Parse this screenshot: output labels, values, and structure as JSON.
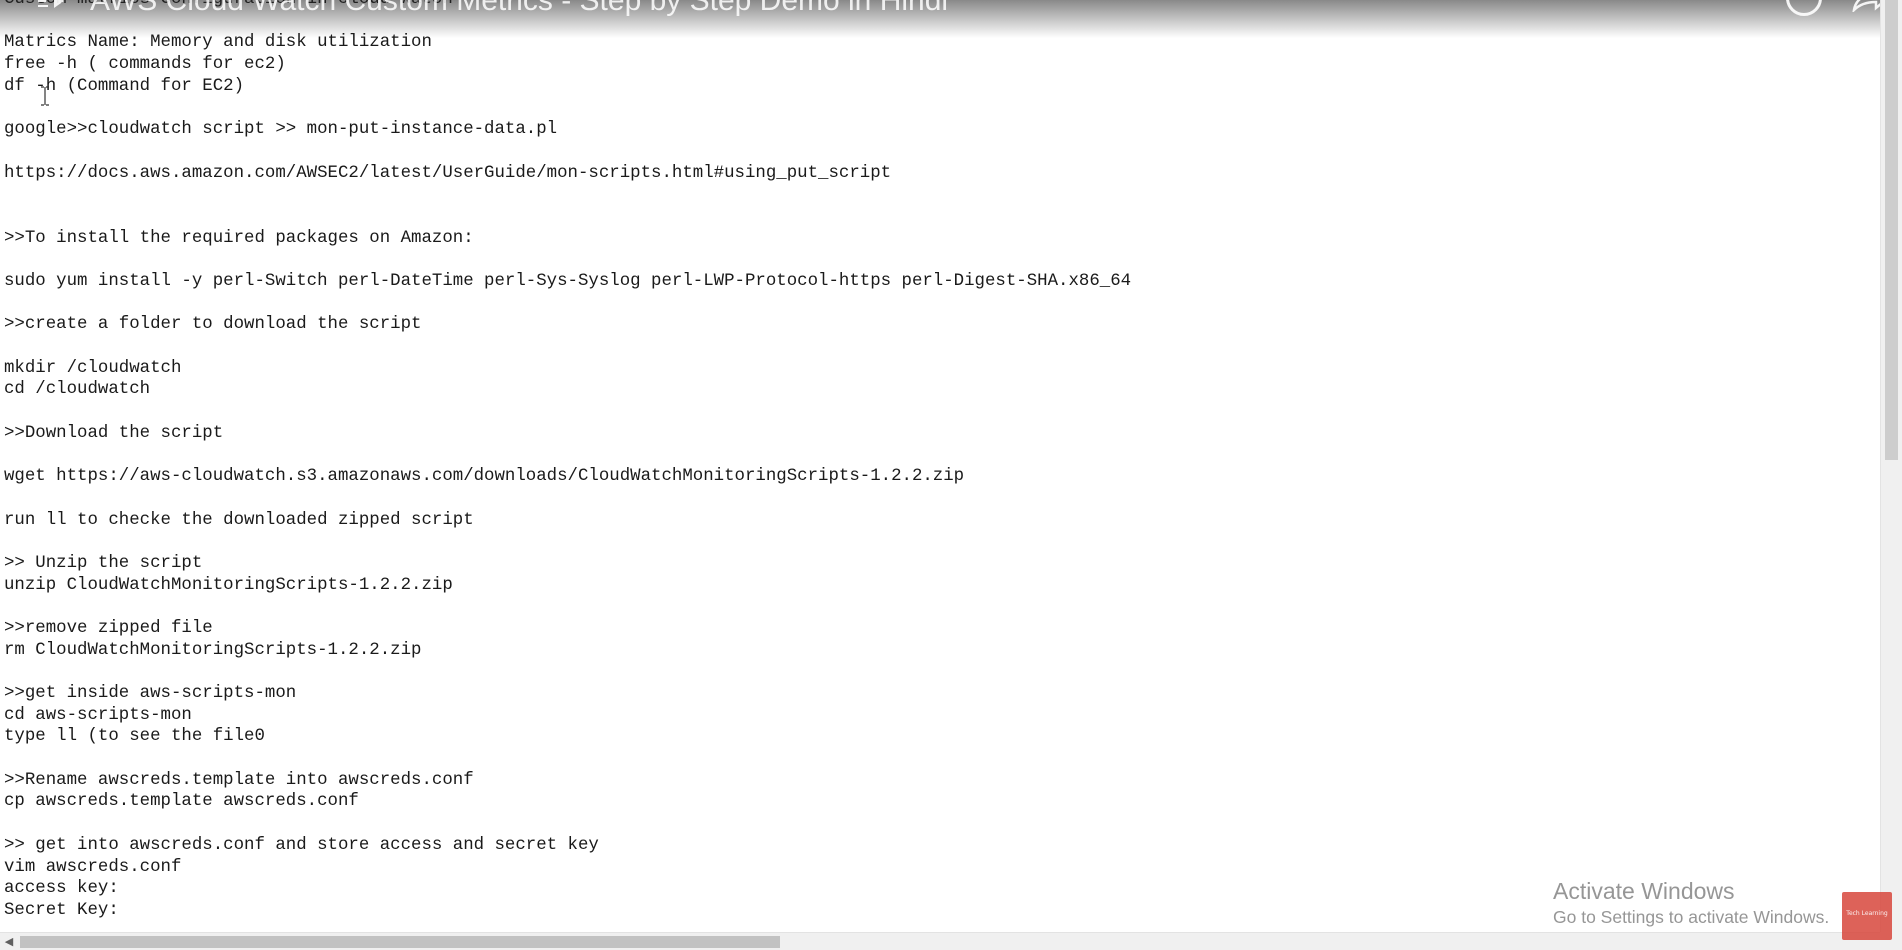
{
  "video": {
    "title": "AWS Cloud Watch Custom Metrics - Step by Step Demo in Hindi"
  },
  "editor": {
    "lines": [
      "Custom matrics Configuration in cloud watch",
      "",
      "Matrics Name: Memory and disk utilization",
      "free -h ( commands for ec2)",
      "df -h (Command for EC2)",
      "",
      "google>>cloudwatch script >> mon-put-instance-data.pl",
      "",
      "https://docs.aws.amazon.com/AWSEC2/latest/UserGuide/mon-scripts.html#using_put_script",
      "",
      "",
      ">>To install the required packages on Amazon:",
      "",
      "sudo yum install -y perl-Switch perl-DateTime perl-Sys-Syslog perl-LWP-Protocol-https perl-Digest-SHA.x86_64",
      "",
      ">>create a folder to download the script",
      "",
      "mkdir /cloudwatch",
      "cd /cloudwatch",
      "",
      ">>Download the script",
      "",
      "wget https://aws-cloudwatch.s3.amazonaws.com/downloads/CloudWatchMonitoringScripts-1.2.2.zip",
      "",
      "run ll to checke the downloaded zipped script",
      "",
      ">> Unzip the script",
      "unzip CloudWatchMonitoringScripts-1.2.2.zip",
      "",
      ">>remove zipped file",
      "rm CloudWatchMonitoringScripts-1.2.2.zip",
      "",
      ">>get inside aws-scripts-mon",
      "cd aws-scripts-mon",
      "type ll (to see the file0",
      "",
      ">>Rename awscreds.template into awscreds.conf",
      "cp awscreds.template awscreds.conf",
      "",
      ">> get into awscreds.conf and store access and secret key",
      "vim awscreds.conf",
      "access key:",
      "Secret Key:"
    ]
  },
  "watermark": {
    "title": "Activate Windows",
    "subtitle": "Go to Settings to activate Windows."
  },
  "logo": {
    "text": "Tech Learning"
  },
  "icons": {
    "play": "play-icon",
    "clock": "clock-icon",
    "share": "share-icon",
    "scroll_left": "scroll-left-arrow-icon",
    "cursor": "text-cursor-icon"
  },
  "colors": {
    "text": "#1a1a1a",
    "background": "#ffffff",
    "scrollbar_track": "#f0f0f0",
    "scrollbar_thumb": "#c2c2c2",
    "logo": "#d7463c"
  }
}
